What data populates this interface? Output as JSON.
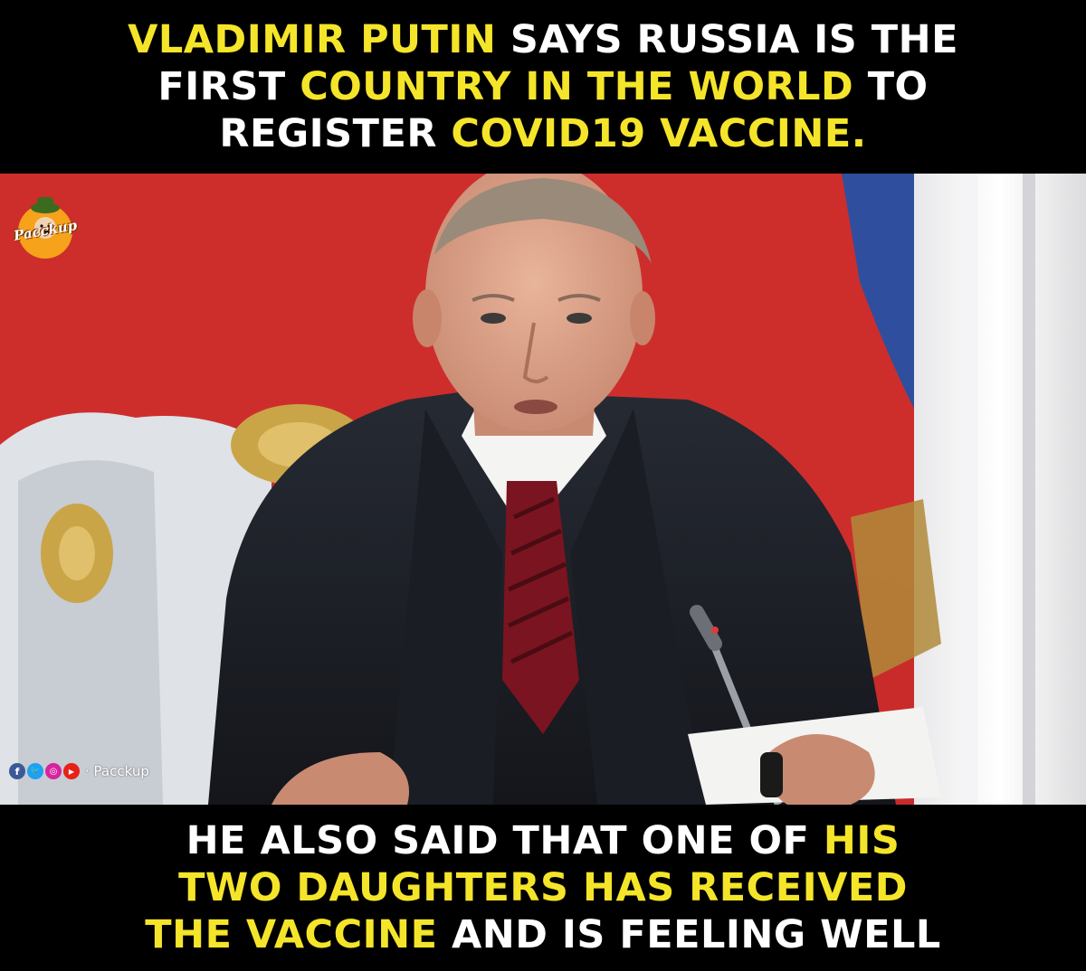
{
  "top_caption": {
    "line1": [
      {
        "text": "VLADIMIR PUTIN",
        "highlight": true
      },
      {
        "text": " SAYS RUSSIA IS THE",
        "highlight": false
      }
    ],
    "line2": [
      {
        "text": "FIRST ",
        "highlight": false
      },
      {
        "text": "COUNTRY IN THE WORLD",
        "highlight": true
      },
      {
        "text": " TO",
        "highlight": false
      }
    ],
    "line3": [
      {
        "text": "REGISTER ",
        "highlight": false
      },
      {
        "text": "COVID19 VACCINE.",
        "highlight": true
      }
    ]
  },
  "bottom_caption": {
    "line1": [
      {
        "text": "HE ALSO SAID THAT ONE OF ",
        "highlight": false
      },
      {
        "text": "HIS",
        "highlight": true
      }
    ],
    "line2": [
      {
        "text": "TWO DAUGHTERS HAS RECEIVED",
        "highlight": true
      }
    ],
    "line3": [
      {
        "text": "THE VACCINE",
        "highlight": true
      },
      {
        "text": " AND IS FEELING WELL",
        "highlight": false
      }
    ]
  },
  "logo": {
    "text": "Pacckup"
  },
  "social": {
    "icons": [
      "facebook-icon",
      "twitter-icon",
      "instagram-icon",
      "youtube-icon"
    ],
    "handle": "· Pacckup"
  },
  "colors": {
    "banner_bg": "#000000",
    "caption_white": "#ffffff",
    "caption_highlight": "#f5e52a",
    "flag_red": "#c92b2a",
    "flag_blue": "#2f4f9e",
    "suit": "#1c1f26",
    "tie": "#7a1420"
  }
}
